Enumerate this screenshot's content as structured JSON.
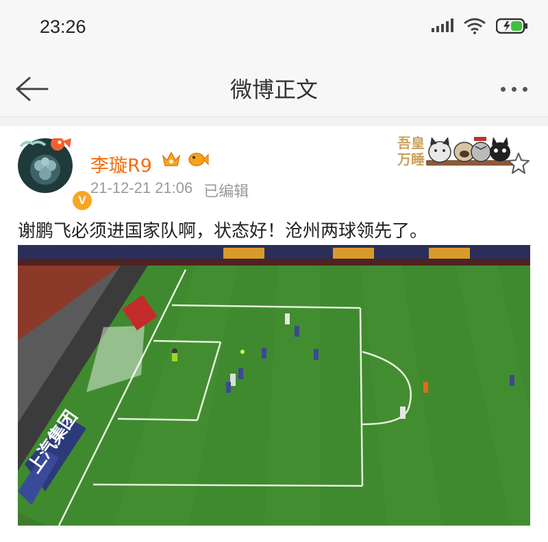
{
  "status_bar": {
    "time": "23:26",
    "icons": [
      "signal-icon",
      "wifi-icon",
      "battery-icon"
    ],
    "battery_color": "#3fbf3f"
  },
  "nav": {
    "back_icon": "back-arrow-icon",
    "title": "微博正文",
    "more_icon": "more-dots-icon"
  },
  "post": {
    "author": {
      "name": "李璇R9",
      "verified_badge": "V",
      "badge_color": "#f7a623",
      "name_color": "#f56b0a"
    },
    "badges": [
      "crown-badge-icon",
      "fish-badge-icon"
    ],
    "date": "21-12-21 21:06",
    "edited_label": "已编辑",
    "sticker_lettering": "吾皇万睡",
    "content": "谢鹏飞必须进国家队啊，状态好！沧州两球领先了。",
    "media": {
      "type": "video-screenshot",
      "ad_board_text": "上汽集团"
    }
  }
}
